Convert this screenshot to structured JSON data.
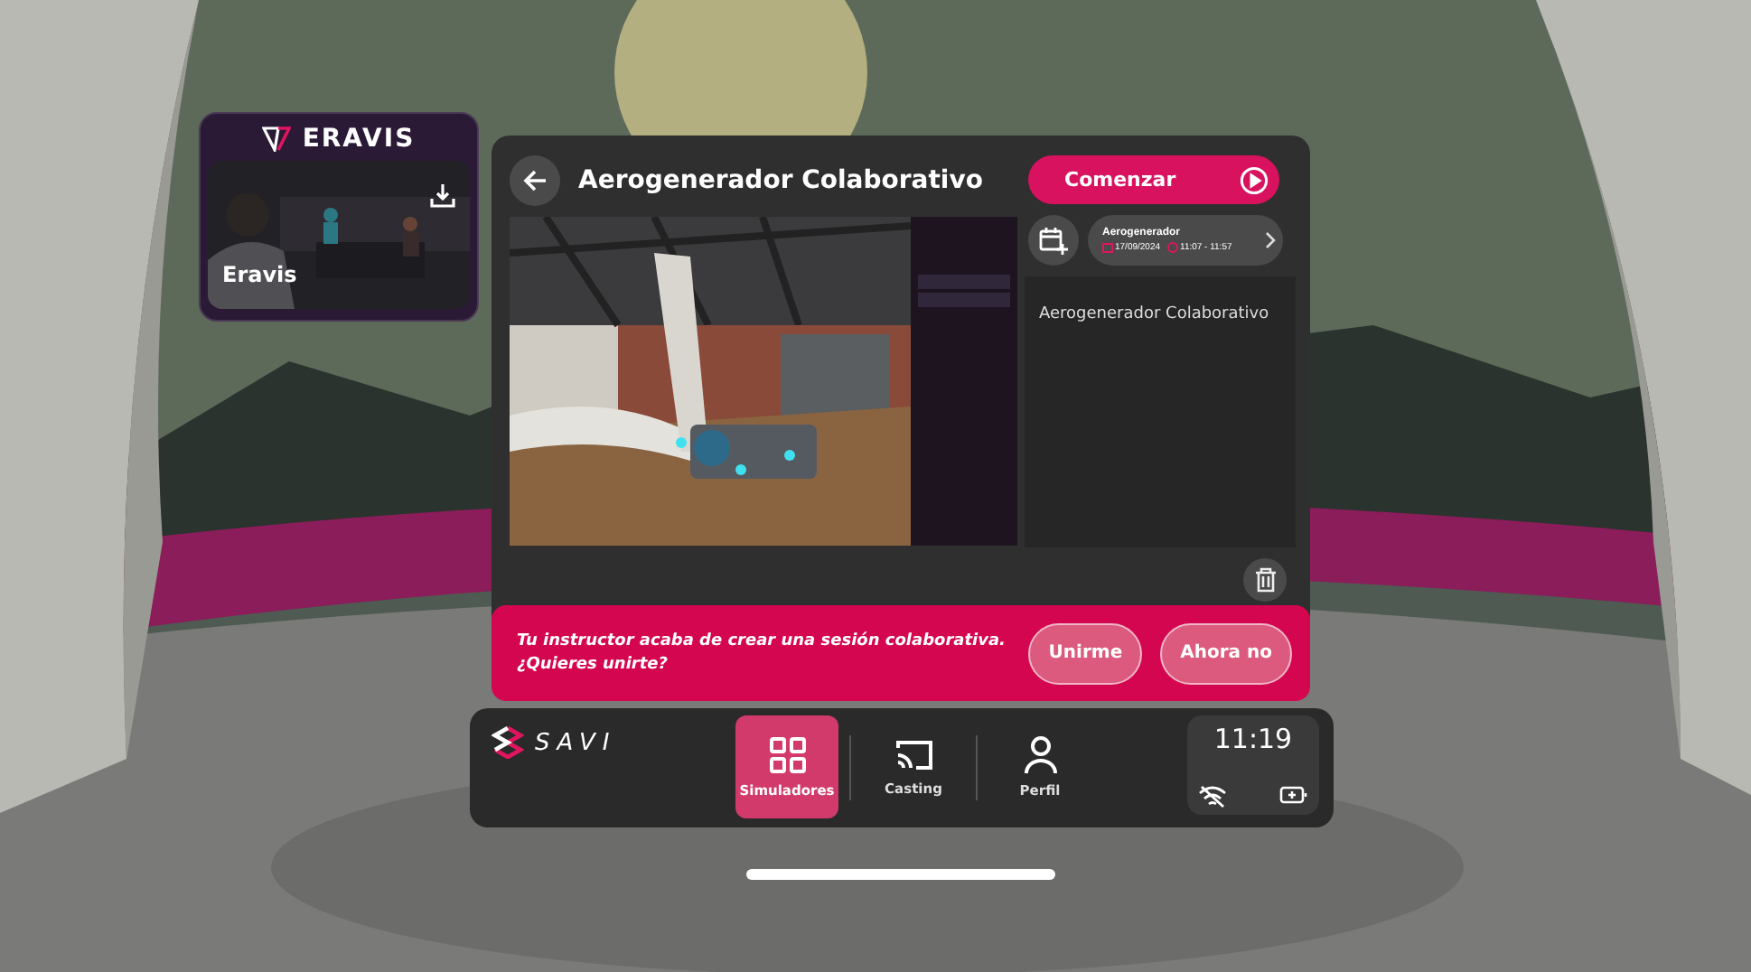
{
  "launcher": {
    "logo": "ERAVIS",
    "app": {
      "name": "Eravis",
      "kind": "picture"
    }
  },
  "simulator": {
    "title": "Aerogenerador Colaborativo",
    "start_button": "Comenzar",
    "session": {
      "name": "Aerogenerador",
      "date": "17/09/2024",
      "time": "11:07 - 11:57"
    },
    "description": "Aerogenerador Colaborativo"
  },
  "notification": {
    "message": "Tu instructor acaba de crear una sesión colaborativa.\n¿Quieres unirte?",
    "buttons": [
      "Unirme",
      "Ahora no"
    ]
  },
  "dock": {
    "brand": "SAVI",
    "tabs": [
      {
        "label": "Simuladores",
        "kind": "grid",
        "selected": true
      },
      {
        "label": "Casting",
        "kind": "cast",
        "selected": false
      },
      {
        "label": "Perfil",
        "kind": "person",
        "selected": false
      }
    ],
    "clock": "11:19",
    "wifi_connected": false
  }
}
